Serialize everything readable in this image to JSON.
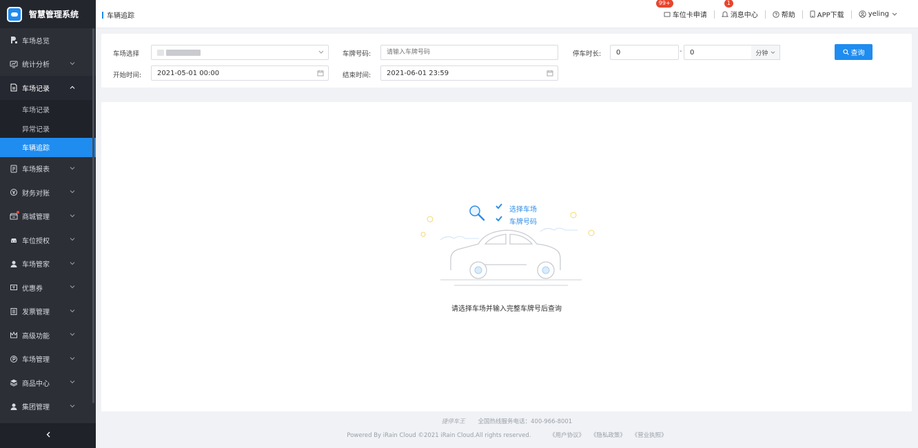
{
  "app": {
    "title": "智慧管理系统"
  },
  "sidebar": {
    "items": [
      {
        "label": "车场总览",
        "icon": "parking-icon"
      },
      {
        "label": "统计分析",
        "icon": "analytics-icon"
      },
      {
        "label": "车场记录",
        "icon": "document-icon",
        "open": true
      },
      {
        "label": "车场报表",
        "icon": "report-icon"
      },
      {
        "label": "财务对账",
        "icon": "finance-icon"
      },
      {
        "label": "商城管理",
        "icon": "shop-icon"
      },
      {
        "label": "车位授权",
        "icon": "car-icon"
      },
      {
        "label": "车场管家",
        "icon": "user-icon"
      },
      {
        "label": "优惠券",
        "icon": "coupon-icon"
      },
      {
        "label": "发票管理",
        "icon": "invoice-icon"
      },
      {
        "label": "高级功能",
        "icon": "crown-icon"
      },
      {
        "label": "车场管理",
        "icon": "parking-circle-icon"
      },
      {
        "label": "商品中心",
        "icon": "layers-icon"
      },
      {
        "label": "集团管理",
        "icon": "group-icon"
      }
    ],
    "sub_items": [
      "车场记录",
      "异常记录",
      "车辆追踪"
    ],
    "active_sub": "车辆追踪"
  },
  "header": {
    "breadcrumb": "车辆追踪",
    "parking_card_apply": "车位卡申请",
    "parking_card_badge": "99+",
    "message_center": "消息中心",
    "message_badge": "1",
    "help": "帮助",
    "app_download": "APP下载",
    "username": "yeling"
  },
  "filter": {
    "lot_label": "车场选择",
    "plate_label": "车牌号码:",
    "plate_placeholder": "请输入车牌号码",
    "duration_label": "停车时长:",
    "duration_from": "0",
    "duration_to": "0",
    "duration_unit": "分钟",
    "duration_sep": "-",
    "start_label": "开始时间:",
    "start_value": "2021-05-01 00:00",
    "end_label": "结束时间:",
    "end_value": "2021-06-01 23:59",
    "query_button": "查询"
  },
  "empty_state": {
    "check1": "选择车场",
    "check2": "车牌号码",
    "message": "请选择车场并输入完整车牌号后查询"
  },
  "footer": {
    "brand": "捷停车王",
    "hotline": "全国热线服务电话：400-966-8001",
    "copyright": "Powered By iRain Cloud ©2021 iRain Cloud.All rights reserved.",
    "user_agreement": "《用户协议》",
    "privacy": "《隐私政策》",
    "license": "《营业执照》"
  },
  "colors": {
    "accent": "#1f8cf0",
    "sidebar_bg": "#2c2f36",
    "badge": "#e8452d"
  }
}
